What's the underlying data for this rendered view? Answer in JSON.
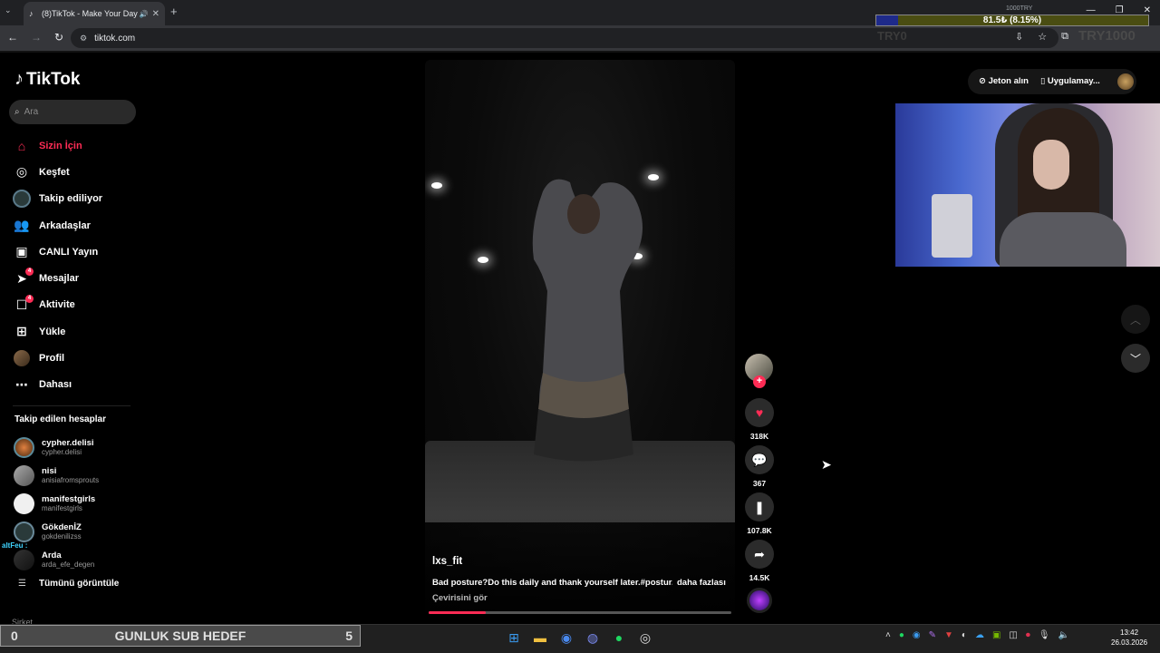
{
  "browser": {
    "tab_title": "(8)TikTok - Make Your Day",
    "url": "tiktok.com"
  },
  "stream_overlay": {
    "goal_top": "1000TRY",
    "goal_text": "81.5₺ (8.15%)",
    "goal_progress": 0.0815,
    "left_label": "TRY0",
    "right_label": "TRY1000",
    "sub_goal": {
      "current": "0",
      "label": "GUNLUK SUB HEDEF",
      "target": "5"
    },
    "chat_message": "altFeu :"
  },
  "tiktok": {
    "logo": "TikTok",
    "search_placeholder": "Ara",
    "nav": [
      {
        "label": "Sizin İçin",
        "icon": "home-icon"
      },
      {
        "label": "Keşfet",
        "icon": "compass-icon"
      },
      {
        "label": "Takip ediliyor",
        "icon": "following-avatar-icon"
      },
      {
        "label": "Arkadaşlar",
        "icon": "friends-icon"
      },
      {
        "label": "CANLI Yayın",
        "icon": "live-icon"
      },
      {
        "label": "Mesajlar",
        "icon": "messages-icon",
        "badge": "4"
      },
      {
        "label": "Aktivite",
        "icon": "activity-icon",
        "badge": "4"
      },
      {
        "label": "Yükle",
        "icon": "upload-icon"
      },
      {
        "label": "Profil",
        "icon": "profile-avatar-icon"
      },
      {
        "label": "Dahası",
        "icon": "more-icon"
      }
    ],
    "following_header": "Takip edilen hesaplar",
    "following": [
      {
        "name": "cypher.delisi",
        "handle": "cypher.delisi"
      },
      {
        "name": "nisi",
        "handle": "anisiafromsprouts"
      },
      {
        "name": "manifestgirls",
        "handle": "manifestgirls"
      },
      {
        "name": "GökdenİZ",
        "handle": "gokdenilizss"
      },
      {
        "name": "Arda",
        "handle": "arda_efe_degen"
      }
    ],
    "see_all": "Tümünü görüntüle",
    "footer_label": "Şirket",
    "header": {
      "coins": "Jeton alın",
      "get_app": "Uygulamay..."
    },
    "video": {
      "username": "lxs_fit",
      "description": "Bad posture?Do this daily and thank yourself later.#postur...",
      "more": "daha fazlası",
      "translate": "Çevirisini gör",
      "progress": 0.19
    },
    "actions": {
      "likes": "318K",
      "comments": "367",
      "saves": "107.8K",
      "shares": "14.5K"
    }
  },
  "taskbar": {
    "time": "13:42",
    "date": "26.03.2026"
  },
  "colors": {
    "accent": "#fe2c55",
    "background": "#000000"
  }
}
